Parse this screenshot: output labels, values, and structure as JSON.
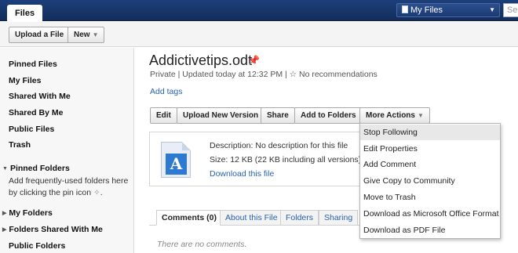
{
  "topbar": {
    "app_tab": "Files",
    "scope_label": "My Files",
    "search_placeholder": "Sea"
  },
  "toolbar": {
    "upload_label": "Upload a File",
    "new_label": "New"
  },
  "sidebar": {
    "items": [
      "Pinned Files",
      "My Files",
      "Shared With Me",
      "Shared By Me",
      "Public Files",
      "Trash"
    ],
    "pinned_folders": "Pinned Folders",
    "pinned_hint": "Add frequently-used folders here by clicking the pin icon",
    "my_folders": "My Folders",
    "folders_shared": "Folders Shared With Me",
    "public_folders": "Public Folders"
  },
  "file": {
    "title": "Addictivetips.odt",
    "visibility": "Private",
    "updated": "Updated today at 12:32 PM",
    "recommendations": "No recommendations",
    "add_tags": "Add tags",
    "description": "Description: No description for this file",
    "size": "Size: 12 KB (22 KB including all versions)",
    "download": "Download this file"
  },
  "actions": {
    "edit": "Edit",
    "upload_version": "Upload New Version",
    "share": "Share",
    "add_to_folders": "Add to Folders",
    "more_actions": "More Actions"
  },
  "menu": {
    "items": [
      "Stop Following",
      "Edit Properties",
      "Add Comment",
      "Give Copy to Community",
      "Move to Trash",
      "Download as Microsoft Office Format",
      "Download as PDF File"
    ]
  },
  "tabs": {
    "comments": "Comments (0)",
    "about": "About this File",
    "folders": "Folders",
    "sharing": "Sharing"
  },
  "comments": {
    "empty": "There are no comments."
  },
  "colors": {
    "topbar": "#1d3f7a",
    "link": "#2762b0",
    "file_icon": "#2f7ad1"
  }
}
